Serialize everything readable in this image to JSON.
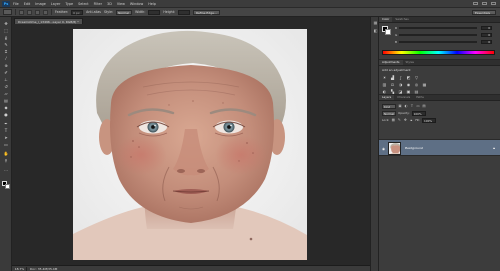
{
  "app": {
    "logo": "Ps"
  },
  "menubar": {
    "items": [
      "File",
      "Edit",
      "Image",
      "Layer",
      "Type",
      "Select",
      "Filter",
      "3D",
      "View",
      "Window",
      "Help"
    ]
  },
  "options": {
    "feather_label": "Feather:",
    "feather_value": "0 px",
    "antialias_label": "Anti-alias",
    "style_label": "Style:",
    "style_value": "Normal",
    "width_label": "Width:",
    "height_label": "Height:",
    "refine_edge_label": "Refine Edge...",
    "workspace": "Essentials"
  },
  "document": {
    "tab_title": "Dreamstime_l_13496...Layer 0, RGB/8) *",
    "zoom": "18.7%",
    "doc_info": "Doc: 35.4M/35.4M"
  },
  "color_panel": {
    "tabs": [
      "Color",
      "Swatches"
    ],
    "r_label": "R",
    "g_label": "G",
    "b_label": "B",
    "r_value": "0",
    "g_value": "0",
    "b_value": "0",
    "foreground_color": "#000000",
    "background_color": "#ffffff"
  },
  "adjustments_panel": {
    "tabs": [
      "Adjustments",
      "Styles"
    ],
    "title": "Add an adjustment"
  },
  "layers_panel": {
    "tabs": [
      "Layers",
      "Channels",
      "Paths"
    ],
    "filter_select": "Kind",
    "blend_mode": "Normal",
    "opacity_label": "Opacity:",
    "opacity_value": "100%",
    "lock_label": "Lock:",
    "fill_label": "Fill:",
    "fill_value": "100%",
    "layers": [
      {
        "name": "Background",
        "selected": true,
        "visible": true,
        "locked": true
      }
    ],
    "selected_color": "#5e6f85"
  }
}
